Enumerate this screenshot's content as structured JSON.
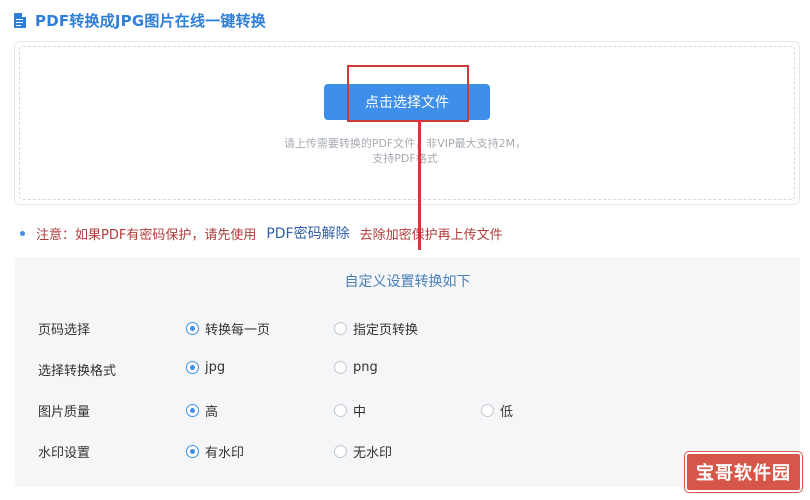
{
  "header": {
    "icon": "document-icon",
    "title": "PDF转换成JPG图片在线一键转换"
  },
  "upload": {
    "button_label": "点击选择文件",
    "hint_line1": "请上传需要转换的PDF文件，非VIP最大支持2M，",
    "hint_line2": "支持PDF格式"
  },
  "notice": {
    "prefix": "注意：如果PDF有密码保护，请先使用",
    "link": "PDF密码解除",
    "suffix": "去除加密保护再上传文件"
  },
  "settings": {
    "title": "自定义设置转换如下",
    "rows": [
      {
        "label": "页码选择",
        "options": [
          "转换每一页",
          "指定页转换"
        ],
        "selected": 0
      },
      {
        "label": "选择转换格式",
        "options": [
          "jpg",
          "png"
        ],
        "selected": 0
      },
      {
        "label": "图片质量",
        "options": [
          "高",
          "中",
          "低"
        ],
        "selected": 0
      },
      {
        "label": "水印设置",
        "options": [
          "有水印",
          "无水印"
        ],
        "selected": 0
      }
    ]
  },
  "watermark": {
    "text": "宝哥软件园"
  },
  "colors": {
    "accent": "#3d8fea",
    "annotation_red": "#d23a3a",
    "notice_text": "#b23b3b",
    "watermark_bg": "#d6564a"
  }
}
